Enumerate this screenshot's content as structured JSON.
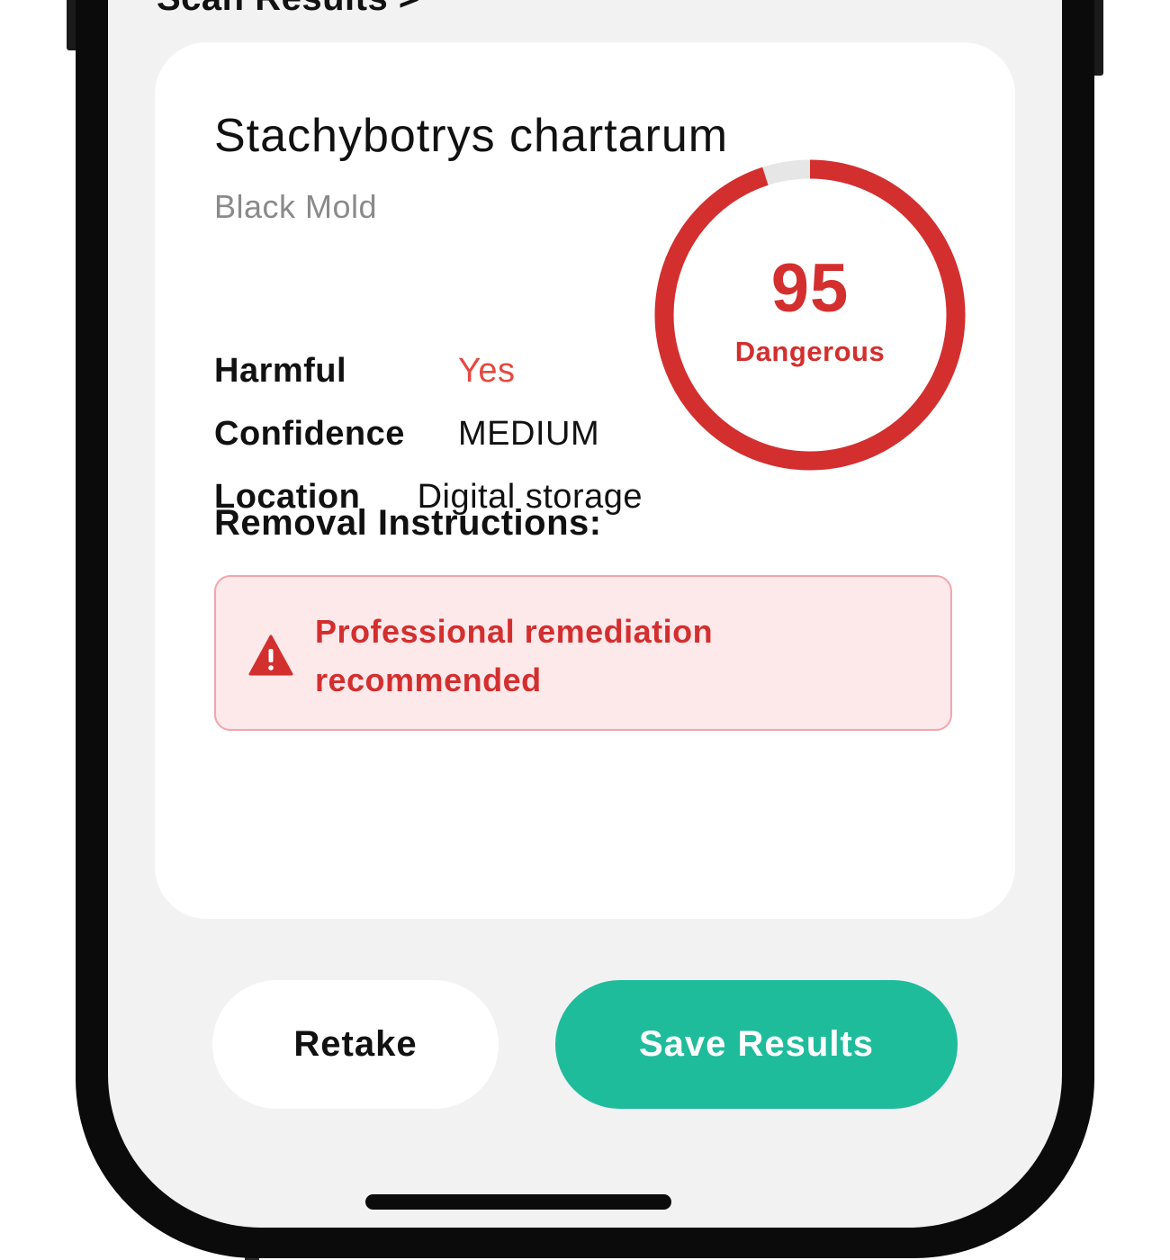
{
  "screen": {
    "section_heading": "Scan Results >"
  },
  "result_card": {
    "species_name": "Stachybotrys chartarum",
    "common_name": "Black Mold",
    "details": [
      {
        "label": "Harmful",
        "value": "Yes"
      },
      {
        "label": "Confidence",
        "value": "MEDIUM"
      },
      {
        "label": "Location",
        "value": "Digital storage"
      }
    ],
    "danger_score": {
      "value": "95",
      "max": 100,
      "label": "Dangerous"
    },
    "removal": {
      "title": "Removal Instructions:",
      "alert_text": "Professional remediation recommended",
      "icon": "warning-triangle-icon"
    }
  },
  "actions": {
    "retake_label": "Retake",
    "save_label": "Save Results"
  },
  "colors": {
    "danger": "#d32f2f",
    "harmful_yes": "#e5483f",
    "primary": "#1fbc9c",
    "alert_bg": "#fde8ea",
    "alert_border": "#f2a5ac",
    "gauge_track": "#e6e6e6",
    "screen_bg": "#f2f2f2"
  }
}
